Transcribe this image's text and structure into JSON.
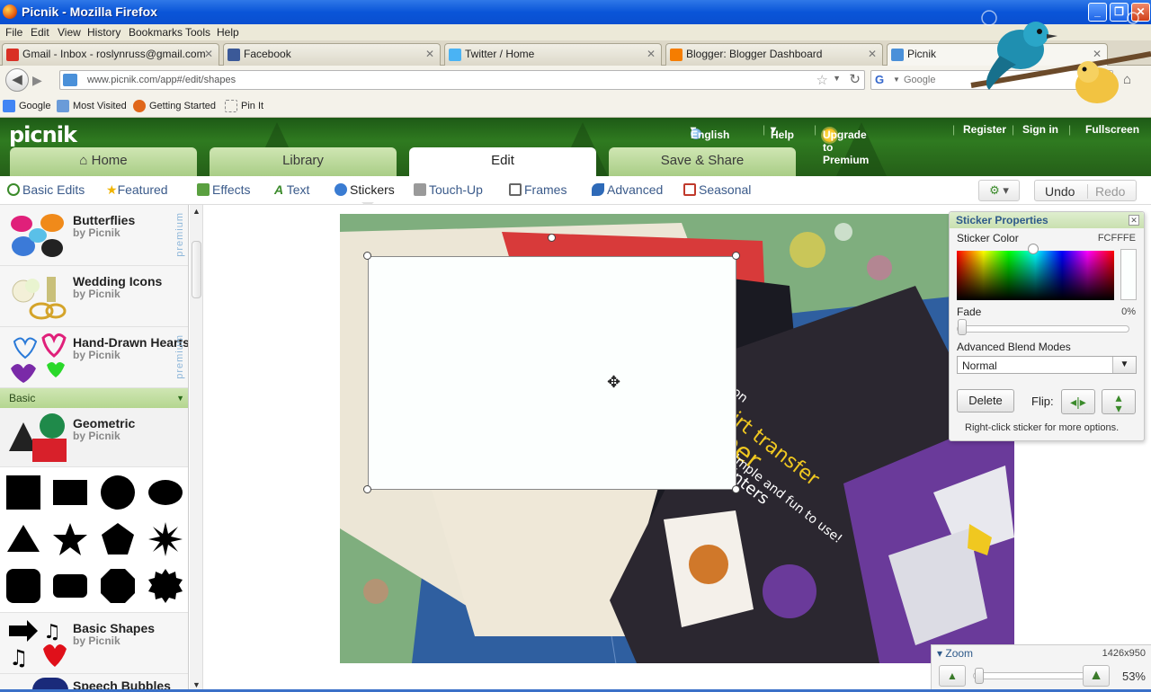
{
  "window": {
    "title": "Picnik - Mozilla Firefox"
  },
  "menu": [
    "File",
    "Edit",
    "View",
    "History",
    "Bookmarks",
    "Tools",
    "Help"
  ],
  "tabs": [
    {
      "label": "Gmail - Inbox - roslynruss@gmail.com",
      "favicon_color": "#d93025"
    },
    {
      "label": "Facebook",
      "favicon_color": "#3b5998"
    },
    {
      "label": "Twitter / Home",
      "favicon_color": "#4ab3f4"
    },
    {
      "label": "Blogger: Blogger Dashboard",
      "favicon_color": "#f57d00"
    },
    {
      "label": "Picnik",
      "favicon_color": "#4a90d9"
    }
  ],
  "nav": {
    "url": "www.picnik.com/app#/edit/shapes",
    "search_placeholder": "Google",
    "search_engine_letter": "G"
  },
  "bookmarks": [
    "Google",
    "Most Visited",
    "Getting Started",
    "Pin It"
  ],
  "picnik": {
    "logo": "picnik",
    "top_links": {
      "language": "English",
      "help": "Help",
      "upgrade": "Upgrade to Premium",
      "register": "Register",
      "signin": "Sign in",
      "fullscreen": "Fullscreen"
    },
    "main_tabs": [
      "Home",
      "Library",
      "Edit",
      "Save & Share"
    ],
    "active_main_tab": "Edit",
    "sub_nav": [
      "Basic Edits",
      "Featured",
      "Effects",
      "Text",
      "Stickers",
      "Touch-Up",
      "Frames",
      "Advanced",
      "Seasonal"
    ],
    "active_sub_nav": "Stickers",
    "undo": "Undo",
    "redo": "Redo"
  },
  "sticker_packs": [
    {
      "name": "Butterflies",
      "by": "by Picnik",
      "premium_label": "premium"
    },
    {
      "name": "Wedding Icons",
      "by": "by Picnik"
    },
    {
      "name": "Hand-Drawn Hearts!",
      "by": "by Picnik",
      "premium_label": "premium"
    },
    {
      "name": "Geometric",
      "by": "by Picnik"
    },
    {
      "name": "Basic Shapes",
      "by": "by Picnik"
    },
    {
      "name": "Speech Bubbles"
    }
  ],
  "section_basic": "Basic",
  "sticker_properties": {
    "title": "Sticker Properties",
    "color_label": "Sticker Color",
    "color_value": "FCFFFE",
    "fade_label": "Fade",
    "fade_value": "0%",
    "blend_label": "Advanced Blend Modes",
    "blend_value": "Normal",
    "delete_label": "Delete",
    "flip_label": "Flip:",
    "hint": "Right-click sticker for more options."
  },
  "zoom": {
    "label": "Zoom",
    "dimensions": "1426x950",
    "percent": "53%"
  },
  "colors": {
    "brand_green": "#2f7a20",
    "tab_green": "#b4d690",
    "link_blue": "#2e5a8a",
    "sticker_fill": "#fcfffe"
  }
}
